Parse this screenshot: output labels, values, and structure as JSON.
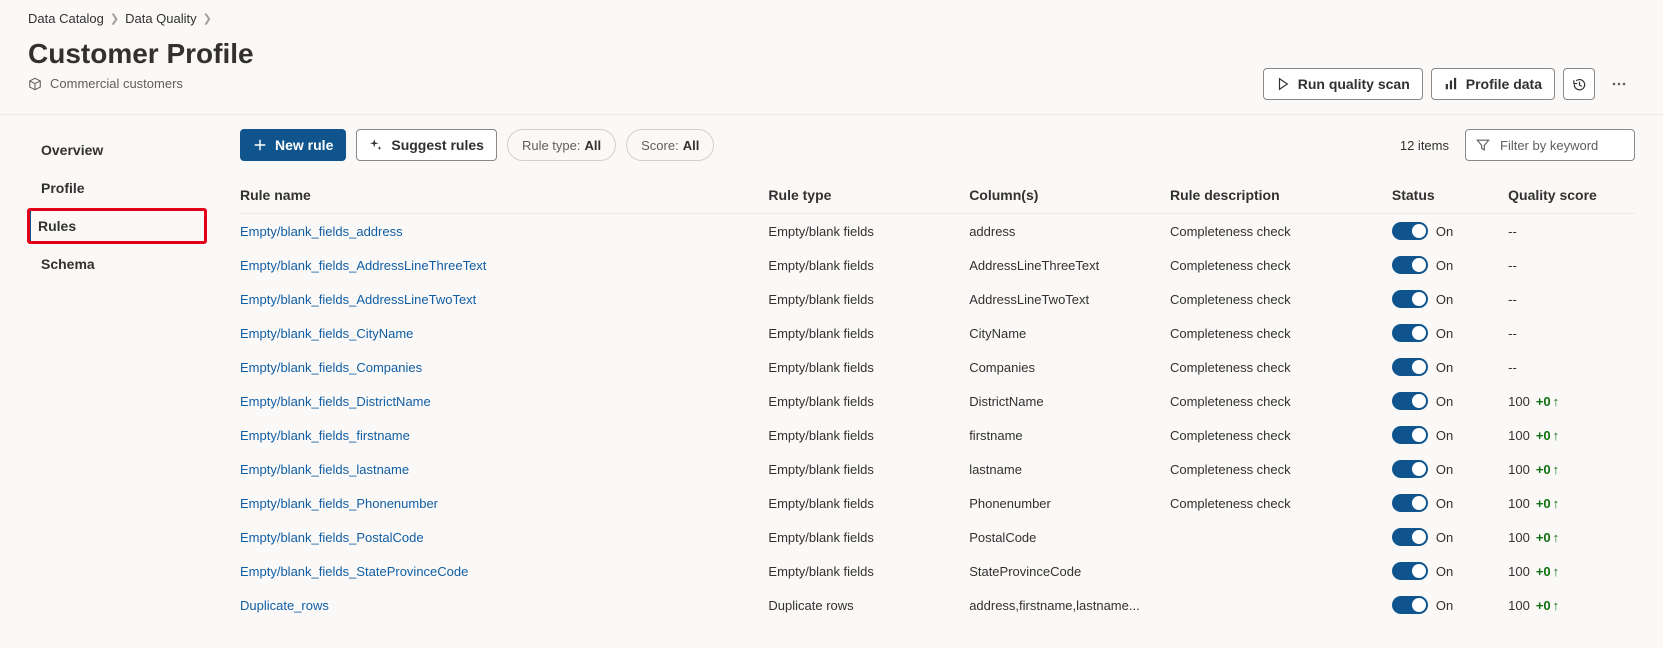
{
  "breadcrumb": [
    {
      "label": "Data Catalog"
    },
    {
      "label": "Data Quality"
    }
  ],
  "page": {
    "title": "Customer Profile",
    "subtitle": "Commercial customers"
  },
  "headerActions": {
    "runScan": "Run quality scan",
    "profileData": "Profile data"
  },
  "sidebar": {
    "items": [
      {
        "label": "Overview",
        "selected": false,
        "highlight": false
      },
      {
        "label": "Profile",
        "selected": false,
        "highlight": false
      },
      {
        "label": "Rules",
        "selected": true,
        "highlight": true
      },
      {
        "label": "Schema",
        "selected": false,
        "highlight": false
      }
    ]
  },
  "toolbar": {
    "newRule": "New rule",
    "suggestRules": "Suggest rules",
    "filterRuleTypeLabel": "Rule type:",
    "filterRuleTypeValue": "All",
    "filterScoreLabel": "Score:",
    "filterScoreValue": "All",
    "itemCount": "12 items",
    "filterPlaceholder": "Filter by keyword"
  },
  "table": {
    "headers": {
      "name": "Rule name",
      "type": "Rule type",
      "columns": "Column(s)",
      "description": "Rule description",
      "status": "Status",
      "score": "Quality score"
    },
    "rows": [
      {
        "name": "Empty/blank_fields_address",
        "type": "Empty/blank fields",
        "columns": "address",
        "description": "Completeness check",
        "statusOn": true,
        "statusLabel": "On",
        "score": "--",
        "delta": null
      },
      {
        "name": "Empty/blank_fields_AddressLineThreeText",
        "type": "Empty/blank fields",
        "columns": "AddressLineThreeText",
        "description": "Completeness check",
        "statusOn": true,
        "statusLabel": "On",
        "score": "--",
        "delta": null
      },
      {
        "name": "Empty/blank_fields_AddressLineTwoText",
        "type": "Empty/blank fields",
        "columns": "AddressLineTwoText",
        "description": "Completeness check",
        "statusOn": true,
        "statusLabel": "On",
        "score": "--",
        "delta": null
      },
      {
        "name": "Empty/blank_fields_CityName",
        "type": "Empty/blank fields",
        "columns": "CityName",
        "description": "Completeness check",
        "statusOn": true,
        "statusLabel": "On",
        "score": "--",
        "delta": null
      },
      {
        "name": "Empty/blank_fields_Companies",
        "type": "Empty/blank fields",
        "columns": "Companies",
        "description": "Completeness check",
        "statusOn": true,
        "statusLabel": "On",
        "score": "--",
        "delta": null
      },
      {
        "name": "Empty/blank_fields_DistrictName",
        "type": "Empty/blank fields",
        "columns": "DistrictName",
        "description": "Completeness check",
        "statusOn": true,
        "statusLabel": "On",
        "score": "100",
        "delta": "+0"
      },
      {
        "name": "Empty/blank_fields_firstname",
        "type": "Empty/blank fields",
        "columns": "firstname",
        "description": "Completeness check",
        "statusOn": true,
        "statusLabel": "On",
        "score": "100",
        "delta": "+0"
      },
      {
        "name": "Empty/blank_fields_lastname",
        "type": "Empty/blank fields",
        "columns": "lastname",
        "description": "Completeness check",
        "statusOn": true,
        "statusLabel": "On",
        "score": "100",
        "delta": "+0"
      },
      {
        "name": "Empty/blank_fields_Phonenumber",
        "type": "Empty/blank fields",
        "columns": "Phonenumber",
        "description": "Completeness check",
        "statusOn": true,
        "statusLabel": "On",
        "score": "100",
        "delta": "+0"
      },
      {
        "name": "Empty/blank_fields_PostalCode",
        "type": "Empty/blank fields",
        "columns": "PostalCode",
        "description": "",
        "statusOn": true,
        "statusLabel": "On",
        "score": "100",
        "delta": "+0"
      },
      {
        "name": "Empty/blank_fields_StateProvinceCode",
        "type": "Empty/blank fields",
        "columns": "StateProvinceCode",
        "description": "",
        "statusOn": true,
        "statusLabel": "On",
        "score": "100",
        "delta": "+0"
      },
      {
        "name": "Duplicate_rows",
        "type": "Duplicate rows",
        "columns": "address,firstname,lastname...",
        "description": "",
        "statusOn": true,
        "statusLabel": "On",
        "score": "100",
        "delta": "+0"
      }
    ]
  }
}
